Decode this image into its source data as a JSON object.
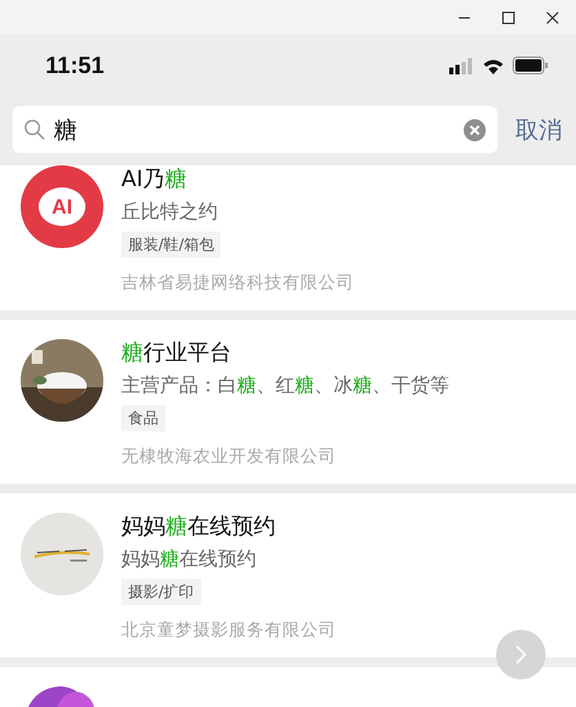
{
  "status_bar": {
    "time": "11:51"
  },
  "search": {
    "value": "糖",
    "cancel": "取消"
  },
  "results": [
    {
      "avatar": {
        "kind": "logo",
        "text": "AI"
      },
      "title": [
        {
          "text": "AI乃",
          "highlight": false
        },
        {
          "text": "糖",
          "highlight": true
        }
      ],
      "subtitle": [
        {
          "text": "丘比特之约",
          "highlight": false
        }
      ],
      "tag": "服装/鞋/箱包",
      "company": "吉林省易捷网络科技有限公司"
    },
    {
      "avatar": {
        "kind": "picture"
      },
      "title": [
        {
          "text": "糖",
          "highlight": true
        },
        {
          "text": "行业平台",
          "highlight": false
        }
      ],
      "subtitle": [
        {
          "text": "主营产品：白",
          "highlight": false
        },
        {
          "text": "糖",
          "highlight": true
        },
        {
          "text": "、红",
          "highlight": false
        },
        {
          "text": "糖",
          "highlight": true
        },
        {
          "text": "、冰",
          "highlight": false
        },
        {
          "text": "糖",
          "highlight": true
        },
        {
          "text": "、干货等",
          "highlight": false
        }
      ],
      "tag": "食品",
      "company": "无棣牧海农业开发有限公司"
    },
    {
      "avatar": {
        "kind": "picture"
      },
      "title": [
        {
          "text": "妈妈",
          "highlight": false
        },
        {
          "text": "糖",
          "highlight": true
        },
        {
          "text": "在线预约",
          "highlight": false
        }
      ],
      "subtitle": [
        {
          "text": "妈妈",
          "highlight": false
        },
        {
          "text": "糖",
          "highlight": true
        },
        {
          "text": "在线预约",
          "highlight": false
        }
      ],
      "tag": "摄影/扩印",
      "company": "北京童梦摄影服务有限公司"
    },
    {
      "avatar": {
        "kind": "picture"
      }
    }
  ]
}
